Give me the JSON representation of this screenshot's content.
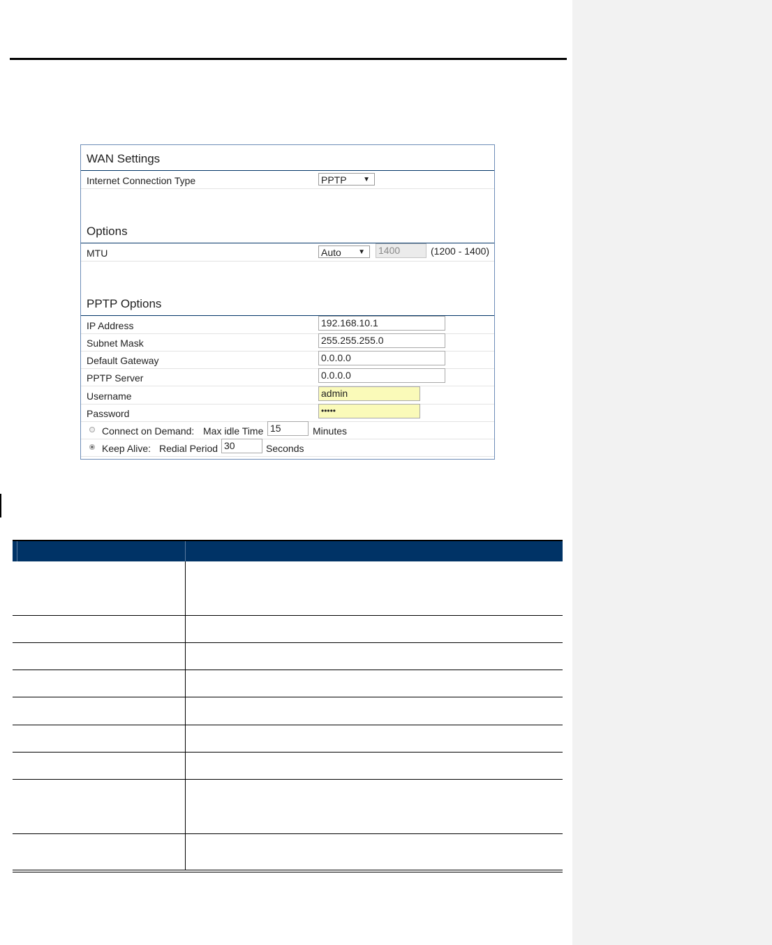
{
  "wan": {
    "title": "WAN Settings",
    "connection_type_label": "Internet Connection Type",
    "connection_type_value": "PPTP"
  },
  "options": {
    "title": "Options",
    "mtu_label": "MTU",
    "mtu_mode": "Auto",
    "mtu_value": "1400",
    "mtu_range": "(1200 - 1400)"
  },
  "pptp": {
    "title": "PPTP Options",
    "ip_label": "IP Address",
    "ip_value": "192.168.10.1",
    "subnet_label": "Subnet Mask",
    "subnet_value": "255.255.255.0",
    "gateway_label": "Default Gateway",
    "gateway_value": "0.0.0.0",
    "server_label": "PPTP Server",
    "server_value": "0.0.0.0",
    "username_label": "Username",
    "username_value": "admin",
    "password_label": "Password",
    "password_value": "•••••",
    "demand_label": "Connect on Demand:",
    "idle_label": "Max idle Time",
    "idle_value": "15",
    "idle_unit": "Minutes",
    "keepalive_label": "Keep Alive:",
    "redial_label": "Redial Period",
    "redial_value": "30",
    "redial_unit": "Seconds"
  }
}
